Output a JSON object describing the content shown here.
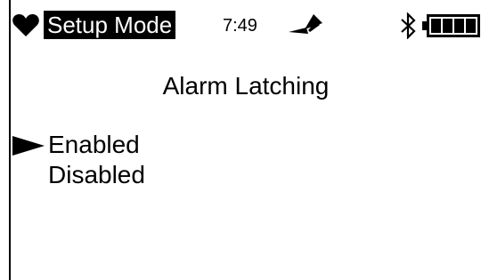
{
  "status_bar": {
    "mode_label": "Setup Mode",
    "time": "7:49",
    "icons": [
      "heart-icon",
      "signal-icon",
      "bluetooth-icon",
      "battery-icon"
    ]
  },
  "screen": {
    "title": "Alarm Latching"
  },
  "menu": {
    "selected_index": 0,
    "items": [
      {
        "label": "Enabled"
      },
      {
        "label": "Disabled"
      }
    ]
  }
}
